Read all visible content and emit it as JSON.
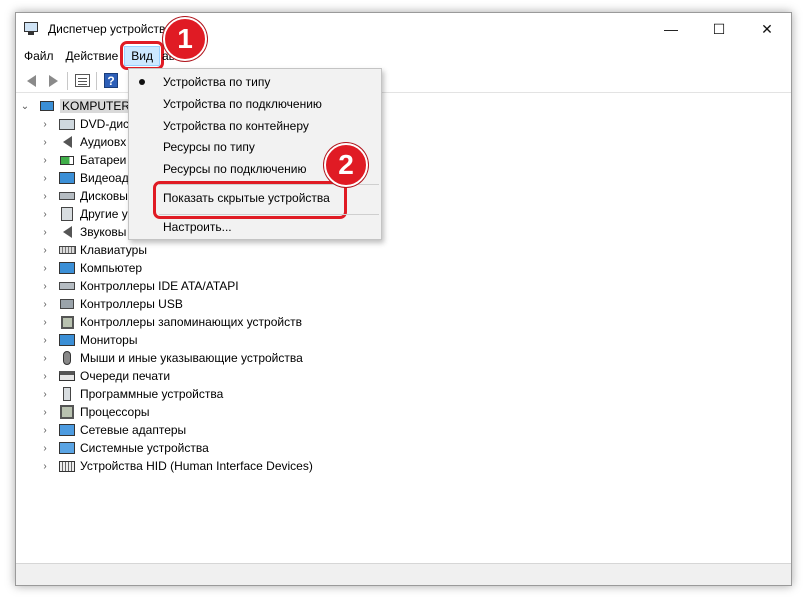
{
  "window": {
    "title": "Диспетчер устройств"
  },
  "window_controls": {
    "minimize": "—",
    "maximize": "☐",
    "close": "✕"
  },
  "menubar": {
    "file": "Файл",
    "action": "Действие",
    "view": "Вид",
    "help_partial": "авка"
  },
  "view_menu": {
    "items": [
      {
        "label": "Устройства по типу",
        "checked": true
      },
      {
        "label": "Устройства по подключению"
      },
      {
        "label": "Устройства по контейнеру"
      },
      {
        "label": "Ресурсы по типу"
      },
      {
        "label": "Ресурсы по подключению"
      },
      {
        "label": "Показать скрытые устройства"
      },
      {
        "label": "Настроить..."
      }
    ]
  },
  "toolbar": {
    "help_glyph": "?"
  },
  "tree": {
    "root": "KOMPUTER",
    "categories": [
      "DVD-диск",
      "Аудиовх",
      "Батареи",
      "Видеоада",
      "Дисковы",
      "Другие у",
      "Звуковы",
      "Клавиатуры",
      "Компьютер",
      "Контроллеры IDE ATA/ATAPI",
      "Контроллеры USB",
      "Контроллеры запоминающих устройств",
      "Мониторы",
      "Мыши и иные указывающие устройства",
      "Очереди печати",
      "Программные устройства",
      "Процессоры",
      "Сетевые адаптеры",
      "Системные устройства",
      "Устройства HID (Human Interface Devices)"
    ]
  },
  "annotations": {
    "step1": "1",
    "step2": "2"
  },
  "colors": {
    "highlight": "#e01b24",
    "menu_open_bg": "#cce8ff",
    "menu_bg": "#f2f2f2"
  }
}
